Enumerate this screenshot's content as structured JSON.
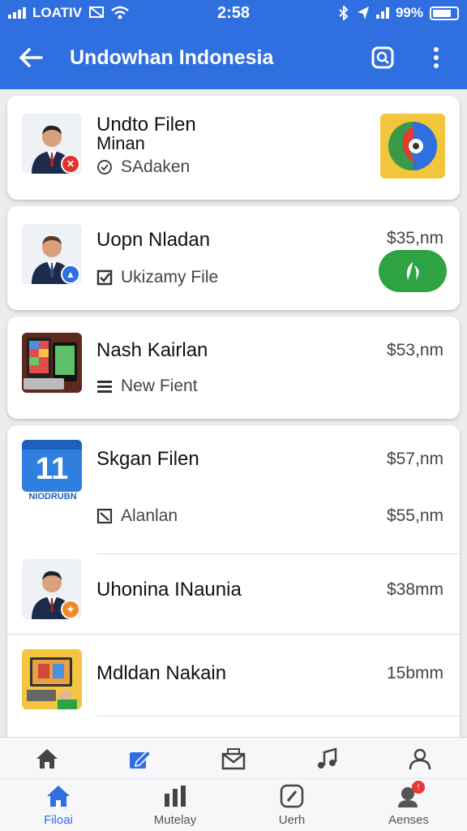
{
  "status_bar": {
    "carrier": "LOATIV",
    "time": "2:58",
    "battery": "99%"
  },
  "app_bar": {
    "title": "Undowhan Indonesia"
  },
  "items": [
    {
      "title": "Undto Filen",
      "subtitle": "Minan",
      "meta": "SAdaken",
      "meta_icon": "circle-check-icon",
      "price": ""
    },
    {
      "title": "Uopn Nladan",
      "meta": "Ukizamy File",
      "meta_icon": "checkbox-icon",
      "price": "$35,nm"
    },
    {
      "title": "Nash Kairlan",
      "meta": "New Fient",
      "meta_icon": "list-icon",
      "price": "$53,nm"
    },
    {
      "title": "Skgan Filen",
      "meta": "Alanlan",
      "meta_icon": "checkbox-icon",
      "price": "$57,nm",
      "meta_price": "$55,nm",
      "thumb_text": "11",
      "thumb_caption": "NIODRUBN"
    },
    {
      "title": "Uhonina INaunia",
      "price": "$38mm"
    },
    {
      "title": "Mdldan Nakain",
      "price": "15bmm"
    }
  ],
  "bottom_nav": {
    "top_icons": [
      "home-icon",
      "edit-icon",
      "mail-icon",
      "music-note-icon",
      "person-icon"
    ],
    "tabs": [
      {
        "label": "Filoai",
        "icon": "home-icon",
        "active": true
      },
      {
        "label": "Mutelay",
        "icon": "stats-icon",
        "active": false
      },
      {
        "label": "Uerh",
        "icon": "compass-icon",
        "active": false
      },
      {
        "label": "Aenses",
        "icon": "person-badge-icon",
        "active": false
      }
    ]
  },
  "colors": {
    "primary": "#2f6fe0",
    "accent_green": "#2ea343",
    "card_bg": "#ffffff",
    "page_bg": "#ececef"
  }
}
